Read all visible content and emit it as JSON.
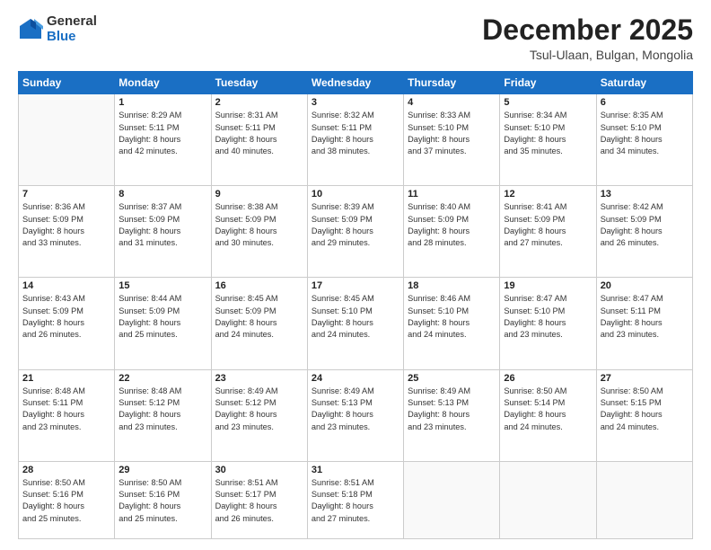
{
  "logo": {
    "general": "General",
    "blue": "Blue"
  },
  "header": {
    "month": "December 2025",
    "location": "Tsul-Ulaan, Bulgan, Mongolia"
  },
  "days_of_week": [
    "Sunday",
    "Monday",
    "Tuesday",
    "Wednesday",
    "Thursday",
    "Friday",
    "Saturday"
  ],
  "weeks": [
    [
      {
        "day": "",
        "info": ""
      },
      {
        "day": "1",
        "info": "Sunrise: 8:29 AM\nSunset: 5:11 PM\nDaylight: 8 hours\nand 42 minutes."
      },
      {
        "day": "2",
        "info": "Sunrise: 8:31 AM\nSunset: 5:11 PM\nDaylight: 8 hours\nand 40 minutes."
      },
      {
        "day": "3",
        "info": "Sunrise: 8:32 AM\nSunset: 5:11 PM\nDaylight: 8 hours\nand 38 minutes."
      },
      {
        "day": "4",
        "info": "Sunrise: 8:33 AM\nSunset: 5:10 PM\nDaylight: 8 hours\nand 37 minutes."
      },
      {
        "day": "5",
        "info": "Sunrise: 8:34 AM\nSunset: 5:10 PM\nDaylight: 8 hours\nand 35 minutes."
      },
      {
        "day": "6",
        "info": "Sunrise: 8:35 AM\nSunset: 5:10 PM\nDaylight: 8 hours\nand 34 minutes."
      }
    ],
    [
      {
        "day": "7",
        "info": "Sunrise: 8:36 AM\nSunset: 5:09 PM\nDaylight: 8 hours\nand 33 minutes."
      },
      {
        "day": "8",
        "info": "Sunrise: 8:37 AM\nSunset: 5:09 PM\nDaylight: 8 hours\nand 31 minutes."
      },
      {
        "day": "9",
        "info": "Sunrise: 8:38 AM\nSunset: 5:09 PM\nDaylight: 8 hours\nand 30 minutes."
      },
      {
        "day": "10",
        "info": "Sunrise: 8:39 AM\nSunset: 5:09 PM\nDaylight: 8 hours\nand 29 minutes."
      },
      {
        "day": "11",
        "info": "Sunrise: 8:40 AM\nSunset: 5:09 PM\nDaylight: 8 hours\nand 28 minutes."
      },
      {
        "day": "12",
        "info": "Sunrise: 8:41 AM\nSunset: 5:09 PM\nDaylight: 8 hours\nand 27 minutes."
      },
      {
        "day": "13",
        "info": "Sunrise: 8:42 AM\nSunset: 5:09 PM\nDaylight: 8 hours\nand 26 minutes."
      }
    ],
    [
      {
        "day": "14",
        "info": "Sunrise: 8:43 AM\nSunset: 5:09 PM\nDaylight: 8 hours\nand 26 minutes."
      },
      {
        "day": "15",
        "info": "Sunrise: 8:44 AM\nSunset: 5:09 PM\nDaylight: 8 hours\nand 25 minutes."
      },
      {
        "day": "16",
        "info": "Sunrise: 8:45 AM\nSunset: 5:09 PM\nDaylight: 8 hours\nand 24 minutes."
      },
      {
        "day": "17",
        "info": "Sunrise: 8:45 AM\nSunset: 5:10 PM\nDaylight: 8 hours\nand 24 minutes."
      },
      {
        "day": "18",
        "info": "Sunrise: 8:46 AM\nSunset: 5:10 PM\nDaylight: 8 hours\nand 24 minutes."
      },
      {
        "day": "19",
        "info": "Sunrise: 8:47 AM\nSunset: 5:10 PM\nDaylight: 8 hours\nand 23 minutes."
      },
      {
        "day": "20",
        "info": "Sunrise: 8:47 AM\nSunset: 5:11 PM\nDaylight: 8 hours\nand 23 minutes."
      }
    ],
    [
      {
        "day": "21",
        "info": "Sunrise: 8:48 AM\nSunset: 5:11 PM\nDaylight: 8 hours\nand 23 minutes."
      },
      {
        "day": "22",
        "info": "Sunrise: 8:48 AM\nSunset: 5:12 PM\nDaylight: 8 hours\nand 23 minutes."
      },
      {
        "day": "23",
        "info": "Sunrise: 8:49 AM\nSunset: 5:12 PM\nDaylight: 8 hours\nand 23 minutes."
      },
      {
        "day": "24",
        "info": "Sunrise: 8:49 AM\nSunset: 5:13 PM\nDaylight: 8 hours\nand 23 minutes."
      },
      {
        "day": "25",
        "info": "Sunrise: 8:49 AM\nSunset: 5:13 PM\nDaylight: 8 hours\nand 23 minutes."
      },
      {
        "day": "26",
        "info": "Sunrise: 8:50 AM\nSunset: 5:14 PM\nDaylight: 8 hours\nand 24 minutes."
      },
      {
        "day": "27",
        "info": "Sunrise: 8:50 AM\nSunset: 5:15 PM\nDaylight: 8 hours\nand 24 minutes."
      }
    ],
    [
      {
        "day": "28",
        "info": "Sunrise: 8:50 AM\nSunset: 5:16 PM\nDaylight: 8 hours\nand 25 minutes."
      },
      {
        "day": "29",
        "info": "Sunrise: 8:50 AM\nSunset: 5:16 PM\nDaylight: 8 hours\nand 25 minutes."
      },
      {
        "day": "30",
        "info": "Sunrise: 8:51 AM\nSunset: 5:17 PM\nDaylight: 8 hours\nand 26 minutes."
      },
      {
        "day": "31",
        "info": "Sunrise: 8:51 AM\nSunset: 5:18 PM\nDaylight: 8 hours\nand 27 minutes."
      },
      {
        "day": "",
        "info": ""
      },
      {
        "day": "",
        "info": ""
      },
      {
        "day": "",
        "info": ""
      }
    ]
  ]
}
